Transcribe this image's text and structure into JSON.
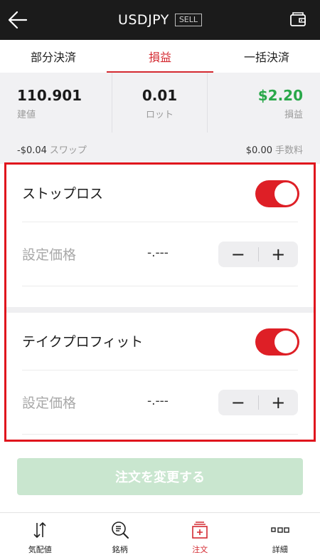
{
  "header": {
    "title": "USDJPY",
    "badge": "SELL"
  },
  "tabs": [
    {
      "label": "部分決済"
    },
    {
      "label": "損益"
    },
    {
      "label": "一括決済"
    }
  ],
  "summary": {
    "rate_value": "110.901",
    "rate_label": "建値",
    "lot_value": "0.01",
    "lot_label": "ロット",
    "pl_value": "$2.20",
    "pl_label": "損益"
  },
  "fees": {
    "swap_value": "-$0.04",
    "swap_label": "スワップ",
    "fee_value": "$0.00",
    "fee_label": "手数料"
  },
  "stop_loss": {
    "title": "ストップロス",
    "enabled": true,
    "price_label": "設定価格",
    "price_value": "-.---"
  },
  "take_profit": {
    "title": "テイクプロフィット",
    "enabled": true,
    "price_label": "設定価格",
    "price_value": "-.---"
  },
  "stepper": {
    "minus": "−",
    "plus": "+"
  },
  "submit": {
    "label": "注文を変更する"
  },
  "nav": [
    {
      "label": "気配値",
      "icon": "quotes-arrows-icon"
    },
    {
      "label": "銘柄",
      "icon": "symbol-search-icon"
    },
    {
      "label": "注文",
      "icon": "order-icon"
    },
    {
      "label": "詳細",
      "icon": "details-icon"
    }
  ],
  "colors": {
    "accent": "#d42a31",
    "toggle_on": "#de1f26",
    "profit": "#2aa84a",
    "highlight_border": "#e0151d"
  }
}
